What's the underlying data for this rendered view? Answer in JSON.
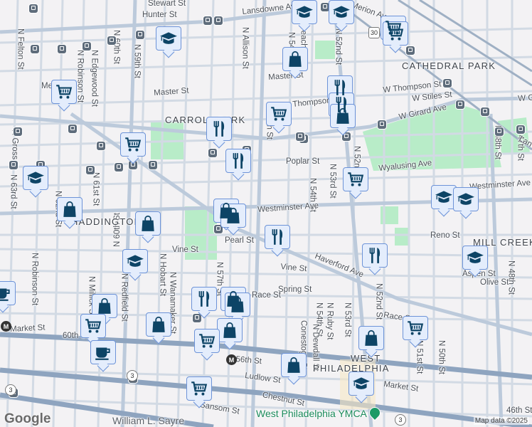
{
  "map": {
    "neighborhoods": [
      "CATHEDRAL PARK",
      "CARROLL PARK",
      "HADDINGTON",
      "MILL CREEK",
      "WEST",
      "PHILADELPHIA"
    ],
    "streets": [
      "Stewart St",
      "Hunter St",
      "Lansdowne Ave",
      "N Felton St",
      "N Robinson St",
      "N Edgewood St",
      "N 60th St",
      "N 59th St",
      "N Allison St",
      "N 54th St",
      "Peach St",
      "N 52nd St",
      "Merion Ave",
      "Media St",
      "Master St",
      "Master St",
      "W Thompson St",
      "W Stiles St",
      "Thompson St",
      "W Girard Ave",
      "W G",
      "N 55th St",
      "Poplar St",
      "N 53rd St",
      "N 54th St",
      "N 52nd St",
      "Wyalusing Ave",
      "Westminster Ave",
      "Westminster Ave",
      "N 48th St",
      "N 47th St",
      "Lan",
      "N 61st St",
      "N 62nd St",
      "N 63rd St",
      "N Gross St",
      "Pearl St",
      "Haverford Ave",
      "Vine St",
      "Vine St",
      "Reno St",
      "Olive St",
      "Aspen St",
      "N 48th St",
      "N 57th St",
      "N Hobart St",
      "N Wanamaker St",
      "N Redfield St",
      "N Robinson St",
      "N Millick St",
      "Spring St",
      "Race St",
      "Race St",
      "N 54th St",
      "N Ruby St",
      "N 53rd St",
      "N 52nd St",
      "Conestoga St",
      "N Dewdall St",
      "Market St",
      "60th St",
      "56th St",
      "Market St",
      "N 51st St",
      "N 50th St",
      "Ludlow St",
      "Chestnut St",
      "Sansom St",
      "46th St",
      "N 60th St"
    ],
    "pois": {
      "sayre": "William L. Sayre",
      "ymca": "West Philadelphia YMCA"
    },
    "route_shields": [
      "3",
      "3",
      "3",
      "30"
    ],
    "metro_label": "M",
    "google_logo": "Google",
    "attribution": "Map data ©2025"
  },
  "marker_style": {
    "fill": "#e4edfc",
    "border": "#6d93d8",
    "icon": "#0d4466"
  },
  "marker_icons": [
    "school-icon",
    "school-icon",
    "cart-icon",
    "cart-icon",
    "bag-icon",
    "school-icon",
    "cart-icon",
    "fork-knife-icon",
    "fork-knife-icon",
    "bag-icon",
    "cart-icon",
    "fork-knife-icon",
    "cart-icon",
    "fork-knife-icon",
    "school-icon",
    "cart-icon",
    "bag-icon",
    "bag-icon",
    "bag-icon",
    "bag-icon",
    "fork-knife-icon",
    "school-icon",
    "school-icon",
    "fork-knife-icon",
    "school-icon",
    "school-icon",
    "cup-icon",
    "bag-icon",
    "fork-knife-icon",
    "bag-icon",
    "bag-icon",
    "cart-icon",
    "bag-icon",
    "bag-icon",
    "cart-icon",
    "bag-icon",
    "cart-icon",
    "cup-icon",
    "bag-icon",
    "school-icon",
    "cart-icon"
  ]
}
